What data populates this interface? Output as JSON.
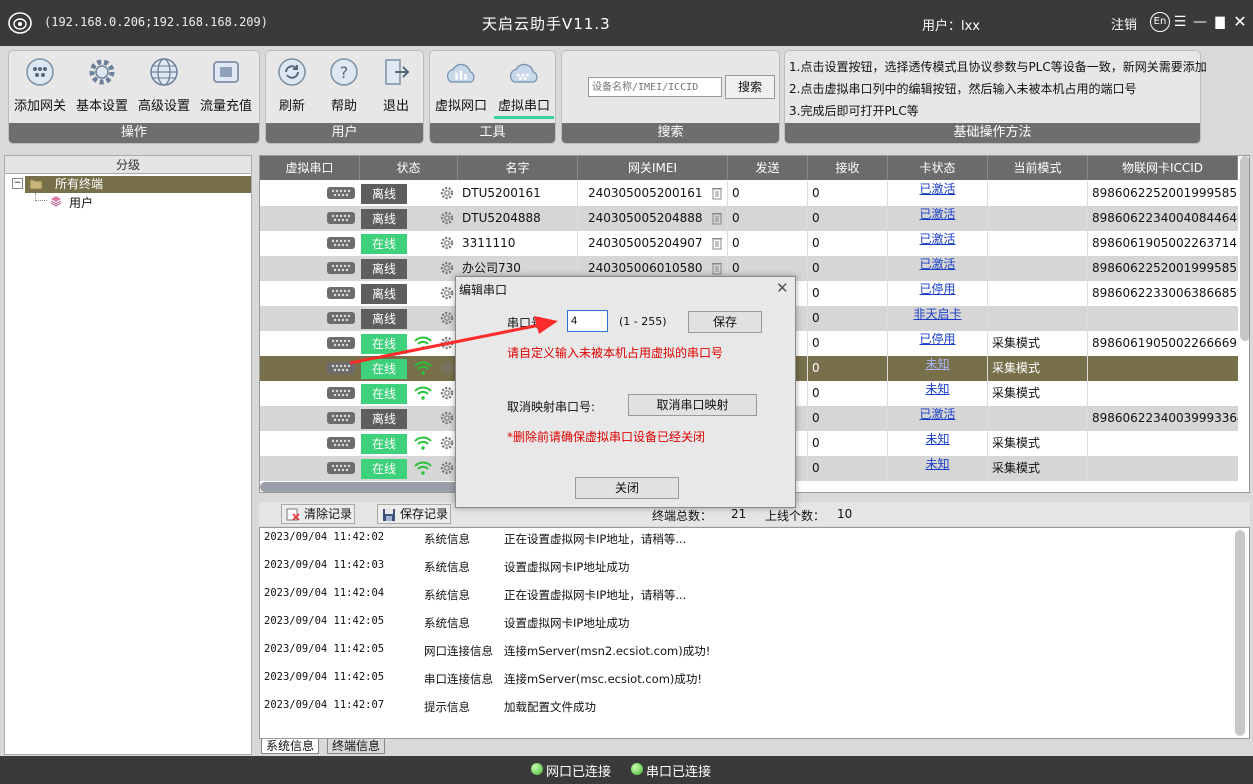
{
  "titlebar": {
    "ips": "(192.168.0.206;192.168.168.209)",
    "title": "天启云助手V11.3",
    "user": "用户：lxx",
    "logout": "注销",
    "en": "En"
  },
  "toolbar": {
    "ops": {
      "label": "操作",
      "add_gateway": "添加网关",
      "basic_settings": "基本设置",
      "advanced_settings": "高级设置",
      "traffic_recharge": "流量充值"
    },
    "user": {
      "label": "用户",
      "refresh": "刷新",
      "help": "帮助",
      "exit": "退出"
    },
    "tools": {
      "label": "工具",
      "virtual_nic": "虚拟网口",
      "virtual_serial": "虚拟串口"
    },
    "search": {
      "label": "搜索",
      "placeholder": "设备名称/IMEI/ICCID",
      "button": "搜索"
    },
    "tips": {
      "label": "基础操作方法",
      "line1": "1.点击设置按钮，选择透传模式且协议参数与PLC等设备一致，新网关需要添加",
      "line2": "2.点击虚拟串口列中的编辑按钮，然后输入未被本机占用的端口号",
      "line3": "3.完成后即可打开PLC等"
    }
  },
  "tree": {
    "header": "分级",
    "root": "所有终端",
    "child": "用户"
  },
  "table": {
    "columns": [
      "虚拟串口",
      "状态",
      "名字",
      "网关IMEI",
      "发送",
      "接收",
      "卡状态",
      "当前模式",
      "物联网卡ICCID"
    ],
    "rows": [
      {
        "status": "离线",
        "name": "DTU5200161",
        "imei": "240305005200161",
        "send": "0",
        "recv": "0",
        "card": "已激活",
        "mode": "",
        "iccid": "89860622520019995857"
      },
      {
        "status": "离线",
        "name": "DTU5204888",
        "imei": "240305005204888",
        "send": "0",
        "recv": "0",
        "card": "已激活",
        "mode": "",
        "iccid": "89860622340040844648"
      },
      {
        "status": "在线",
        "name": "3311110",
        "imei": "240305005204907",
        "send": "0",
        "recv": "0",
        "card": "已激活",
        "mode": "",
        "iccid": "89860619050022637143"
      },
      {
        "status": "离线",
        "name": "办公司730",
        "imei": "240305006010580",
        "send": "0",
        "recv": "0",
        "card": "已激活",
        "mode": "",
        "iccid": "89860622520019995857"
      },
      {
        "status": "离线",
        "name": "",
        "imei": "",
        "send": "",
        "recv": "0",
        "card": "已停用",
        "mode": "",
        "iccid": "89860622330063866859"
      },
      {
        "status": "离线",
        "name": "",
        "imei": "",
        "send": "",
        "recv": "0",
        "card": "非天启卡",
        "mode": "",
        "iccid": ""
      },
      {
        "status": "在线",
        "name": "",
        "imei": "",
        "send": "",
        "recv": "0",
        "card": "已停用",
        "mode": "采集模式",
        "iccid": "89860619050022666696"
      },
      {
        "status": "在线",
        "name": "",
        "imei": "",
        "send": "",
        "recv": "0",
        "card": "未知",
        "mode": "采集模式",
        "iccid": ""
      },
      {
        "status": "在线",
        "name": "",
        "imei": "",
        "send": "",
        "recv": "0",
        "card": "未知",
        "mode": "采集模式",
        "iccid": ""
      },
      {
        "status": "离线",
        "name": "",
        "imei": "",
        "send": "",
        "recv": "0",
        "card": "已激活",
        "mode": "",
        "iccid": "89860622340039993364"
      },
      {
        "status": "在线",
        "name": "",
        "imei": "",
        "send": "",
        "recv": "0",
        "card": "未知",
        "mode": "采集模式",
        "iccid": ""
      },
      {
        "status": "在线",
        "name": "",
        "imei": "",
        "send": "",
        "recv": "0",
        "card": "未知",
        "mode": "采集模式",
        "iccid": ""
      }
    ]
  },
  "logbar": {
    "clear": "清除记录",
    "save": "保存记录",
    "total_label": "终端总数：",
    "total": "21",
    "online_label": "上线个数：",
    "online": "10"
  },
  "log": [
    {
      "time": "2023/09/04 11:42:02",
      "type": "系统信息",
      "msg": "正在设置虚拟网卡IP地址，请稍等..."
    },
    {
      "time": "2023/09/04 11:42:03",
      "type": "系统信息",
      "msg": "设置虚拟网卡IP地址成功"
    },
    {
      "time": "2023/09/04 11:42:04",
      "type": "系统信息",
      "msg": "正在设置虚拟网卡IP地址，请稍等..."
    },
    {
      "time": "2023/09/04 11:42:05",
      "type": "系统信息",
      "msg": "设置虚拟网卡IP地址成功"
    },
    {
      "time": "2023/09/04 11:42:05",
      "type": "网口连接信息",
      "msg": "连接mServer(msn2.ecsiot.com)成功!"
    },
    {
      "time": "2023/09/04 11:42:05",
      "type": "串口连接信息",
      "msg": "连接mServer(msc.ecsiot.com)成功!"
    },
    {
      "time": "2023/09/04 11:42:07",
      "type": "提示信息",
      "msg": "加载配置文件成功"
    }
  ],
  "logtabs": {
    "system": "系统信息",
    "terminal": "终端信息"
  },
  "dialog": {
    "title": "编辑串口",
    "port_label": "串口号",
    "port_value": "4",
    "range": "(1 - 255)",
    "save": "保存",
    "hint": "请自定义输入未被本机占用虚拟的串口号",
    "unmap_label": "取消映射串口号:",
    "unmap_button": "取消串口映射",
    "warning": "*删除前请确保虚拟串口设备已经关闭",
    "close": "关闭"
  },
  "statusbar": {
    "net": "网口已连接",
    "serial": "串口已连接"
  },
  "colors": {
    "online": "#3cd17a",
    "offline": "#5e5e5e",
    "selected": "#77704a",
    "link": "#1a3fc8",
    "warning": "#e00000"
  }
}
